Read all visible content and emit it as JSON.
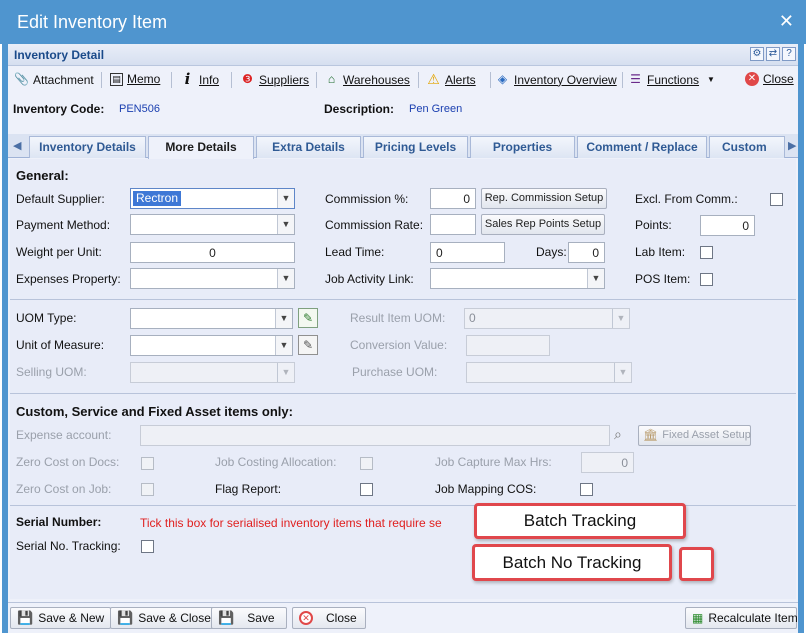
{
  "window": {
    "title": "Edit Inventory Item"
  },
  "section_header": "Inventory Detail",
  "toolbar": {
    "attachment": "Attachment",
    "memo": "Memo",
    "info": "Info",
    "suppliers": "Suppliers",
    "warehouses": "Warehouses",
    "alerts": "Alerts",
    "inventory_overview": "Inventory Overview",
    "functions": "Functions",
    "close": "Close"
  },
  "header_fields": {
    "code_label": "Inventory Code:",
    "code_value": "PEN506",
    "description_label": "Description:",
    "description_value": "Pen Green"
  },
  "tabs": [
    "Inventory Details",
    "More Details",
    "Extra Details",
    "Pricing Levels",
    "Properties",
    "Comment / Replace",
    "Custom Fie"
  ],
  "general": {
    "heading": "General",
    "default_supplier_label": "Default Supplier:",
    "default_supplier_value": "Rectron",
    "payment_method_label": "Payment Method:",
    "weight_label": "Weight per Unit:",
    "weight_value": "0",
    "expenses_label": "Expenses Property:",
    "commission_pct_label": "Commission %:",
    "commission_pct_value": "0",
    "rep_commission_btn": "Rep. Commission Setup",
    "commission_rate_label": "Commission Rate:",
    "sales_rep_btn": "Sales Rep Points Setup",
    "lead_time_label": "Lead Time:",
    "lead_time_value": "0",
    "days_label": "Days:",
    "days_value": "0",
    "job_activity_label": "Job Activity Link:",
    "excl_comm_label": "Excl. From Comm.:",
    "points_label": "Points:",
    "points_value": "0",
    "lab_item_label": "Lab Item:",
    "pos_item_label": "POS Item:"
  },
  "uom": {
    "uom_type_label": "UOM Type:",
    "unit_measure_label": "Unit of Measure:",
    "selling_uom_label": "Selling UOM:",
    "result_item_label": "Result Item UOM:",
    "result_item_value": "0",
    "conversion_label": "Conversion Value:",
    "purchase_uom_label": "Purchase UOM:"
  },
  "custom": {
    "heading": "Custom, Service and Fixed Asset items only",
    "expense_account_label": "Expense account:",
    "fixed_asset_btn": "Fixed Asset Setup",
    "zero_cost_docs_label": "Zero Cost on Docs:",
    "job_costing_label": "Job Costing Allocation:",
    "job_capture_label": "Job Capture Max Hrs:",
    "job_capture_value": "0",
    "zero_cost_job_label": "Zero Cost on Job:",
    "flag_report_label": "Flag Report:",
    "job_mapping_label": "Job Mapping COS:"
  },
  "serial": {
    "heading": "Serial Number:",
    "hint": "Tick this box for serialised inventory items that require se",
    "tracking_label": "Serial No. Tracking:"
  },
  "callouts": {
    "batch_tracking": "Batch Tracking",
    "batch_no_tracking": "Batch No Tracking"
  },
  "footer": {
    "save_new": "Save & New",
    "save_close": "Save & Close",
    "save": "Save",
    "close": "Close",
    "recalculate": "Recalculate Item"
  }
}
